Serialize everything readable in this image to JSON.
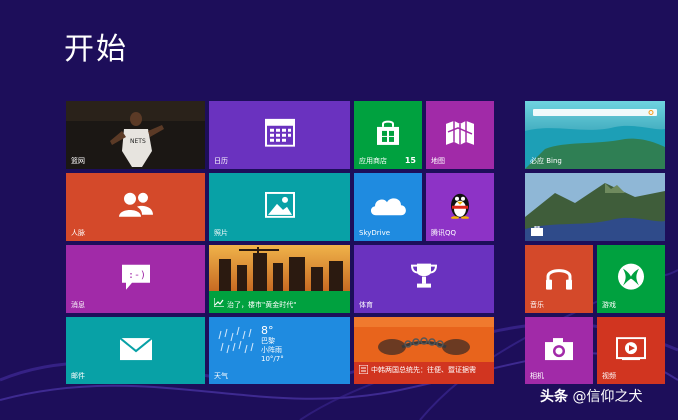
{
  "title": "开始",
  "colors": {
    "background": "#1d0e5a",
    "purple": "#6a32bf",
    "orange": "#d4492a",
    "teal": "#08a1a6",
    "green": "#00a13f",
    "magenta": "#a12aa8",
    "blue": "#1f8be0",
    "red": "#d13520",
    "violet": "#8d33c6"
  },
  "tiles": {
    "sports_hero": {
      "label": "篮网",
      "icon": "basketball-player-photo"
    },
    "calendar": {
      "label": "日历",
      "icon": "calendar-icon"
    },
    "store": {
      "label": "应用商店",
      "badge": "15",
      "icon": "store-bag-icon"
    },
    "maps": {
      "label": "地图",
      "icon": "map-icon"
    },
    "bing": {
      "label": "必应 Bing",
      "icon": "bing-search-photo"
    },
    "people": {
      "label": "人脉",
      "icon": "people-icon"
    },
    "photos": {
      "label": "照片",
      "icon": "photo-icon"
    },
    "skydrive": {
      "label": "SkyDrive",
      "icon": "cloud-icon"
    },
    "qq": {
      "label": "腾讯QQ",
      "icon": "penguin-icon"
    },
    "travel": {
      "label": "",
      "icon": "mountain-photo"
    },
    "messaging": {
      "label": "消息",
      "icon": "chat-icon"
    },
    "finance": {
      "label": "治了，楼市\"黄金时代\"",
      "icon": "finance-chart-icon"
    },
    "sports": {
      "label": "体育",
      "icon": "trophy-icon"
    },
    "music": {
      "label": "音乐",
      "icon": "headphones-icon"
    },
    "games": {
      "label": "游戏",
      "icon": "xbox-controller-icon"
    },
    "mail": {
      "label": "邮件",
      "icon": "envelope-icon"
    },
    "weather": {
      "label": "天气",
      "temp": "8°",
      "city": "巴黎",
      "condition": "小阵雨",
      "range": "10°/7°",
      "icon": "rain-icon"
    },
    "news": {
      "label": "中韩两国总统先：往便、暨证据需",
      "icon": "news-photo"
    },
    "camera": {
      "label": "相机",
      "icon": "camera-icon"
    },
    "video": {
      "label": "视频",
      "icon": "video-play-icon"
    }
  },
  "watermark": {
    "brand": "头条",
    "author": "@信仰之犬"
  }
}
